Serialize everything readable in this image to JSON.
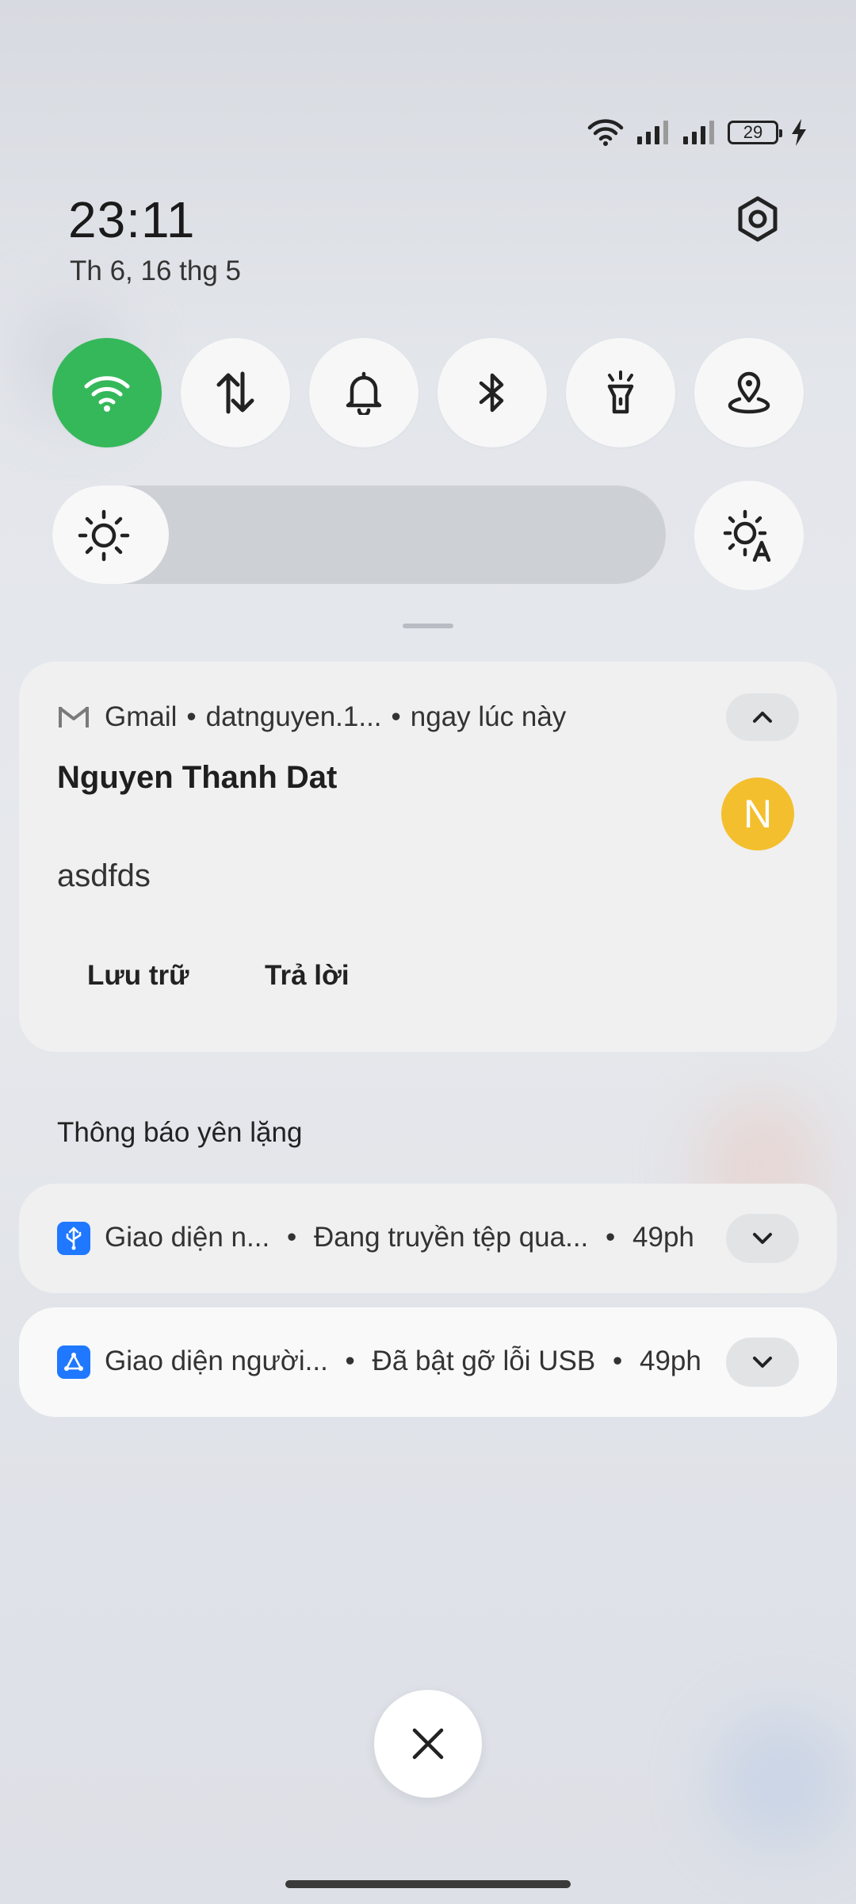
{
  "status_bar": {
    "battery_level": "29",
    "icons": [
      "wifi-icon",
      "signal-sim1-icon",
      "signal-sim2-icon",
      "battery-icon",
      "charging-icon"
    ]
  },
  "clock": {
    "time": "23:11",
    "date": "Th 6, 16 thg 5"
  },
  "quick_toggles": [
    {
      "name": "wifi",
      "icon": "wifi-icon",
      "active": true,
      "color": "#35b85a"
    },
    {
      "name": "mobile-data",
      "icon": "data-arrows-icon",
      "active": false
    },
    {
      "name": "sound",
      "icon": "bell-icon",
      "active": false
    },
    {
      "name": "bluetooth",
      "icon": "bluetooth-icon",
      "active": false
    },
    {
      "name": "flashlight",
      "icon": "flashlight-icon",
      "active": false
    },
    {
      "name": "location",
      "icon": "location-icon",
      "active": false
    }
  ],
  "brightness": {
    "level": 0.19,
    "auto_icon": "auto-brightness-icon"
  },
  "gmail_notification": {
    "app": "Gmail",
    "account": "datnguyen.1...",
    "time": "ngay lúc này",
    "sender": "Nguyen Thanh Dat",
    "avatar_letter": "N",
    "avatar_color": "#f4bf2e",
    "message": "asdfds",
    "actions": [
      "Lưu trữ",
      "Trả lời"
    ]
  },
  "silent_section_label": "Thông báo yên lặng",
  "silent_notifications": [
    {
      "app": "Giao diện n...",
      "text": "Đang truyền tệp qua...",
      "time": "49ph",
      "icon": "usb-icon"
    },
    {
      "app": "Giao diện người...",
      "text": "Đã bật gỡ lỗi USB",
      "time": "49ph",
      "icon": "debug-icon"
    }
  ],
  "dot_separator": "•"
}
